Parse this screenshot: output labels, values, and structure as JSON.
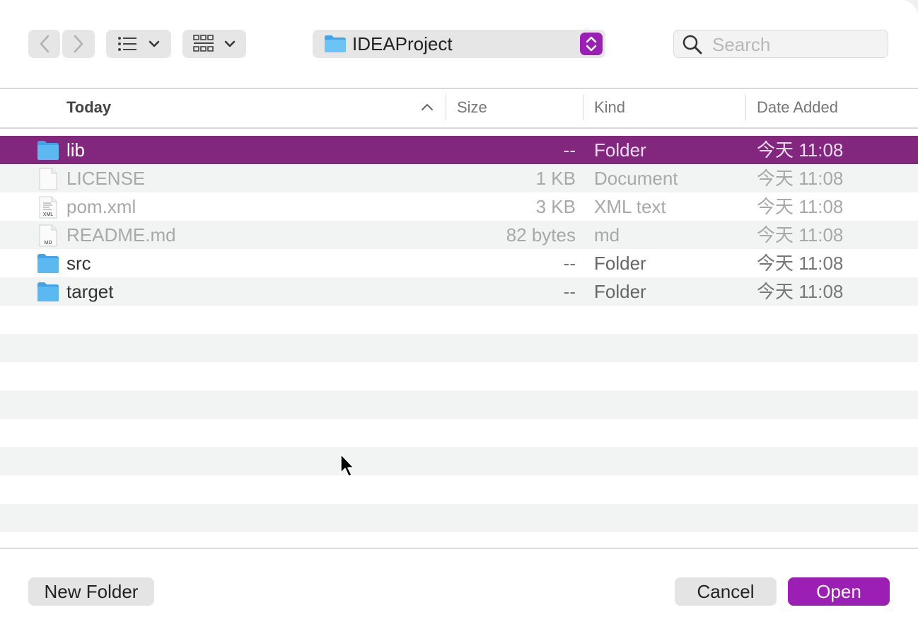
{
  "toolbar": {
    "location": "IDEAProject",
    "search_placeholder": "Search"
  },
  "columns": {
    "name": "Today",
    "size": "Size",
    "kind": "Kind",
    "date": "Date Added"
  },
  "files": [
    {
      "name": "lib",
      "size": "--",
      "kind": "Folder",
      "date": "今天 11:08",
      "icon": "folder-icon",
      "selected": true,
      "dim": false
    },
    {
      "name": "LICENSE",
      "size": "1 KB",
      "kind": "Document",
      "date": "今天 11:08",
      "icon": "document-icon",
      "selected": false,
      "dim": true
    },
    {
      "name": "pom.xml",
      "size": "3 KB",
      "kind": "XML text",
      "date": "今天 11:08",
      "icon": "xml-file-icon",
      "selected": false,
      "dim": true
    },
    {
      "name": "README.md",
      "size": "82 bytes",
      "kind": "md",
      "date": "今天 11:08",
      "icon": "md-file-icon",
      "selected": false,
      "dim": true
    },
    {
      "name": "src",
      "size": "--",
      "kind": "Folder",
      "date": "今天 11:08",
      "icon": "folder-icon",
      "selected": false,
      "dim": false
    },
    {
      "name": "target",
      "size": "--",
      "kind": "Folder",
      "date": "今天 11:08",
      "icon": "folder-icon",
      "selected": false,
      "dim": false
    }
  ],
  "file_icon_labels": {
    "xml": "XML",
    "md": "MD"
  },
  "footer": {
    "new_folder": "New Folder",
    "cancel": "Cancel",
    "open": "Open"
  },
  "colors": {
    "accent": "#9b1fb4",
    "selection": "#83277e",
    "folder": "#5bb8f0"
  }
}
